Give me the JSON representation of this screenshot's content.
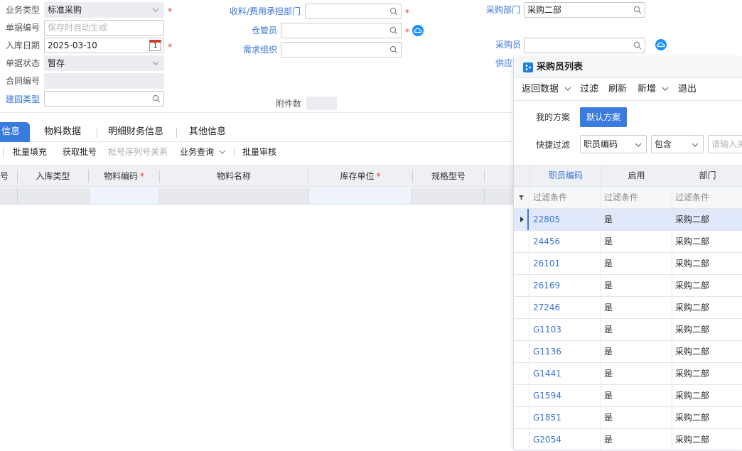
{
  "form": {
    "biz_type_label": "业务类型",
    "biz_type_value": "标准采购",
    "doc_no_label": "单据编号",
    "doc_no_placeholder": "保存时自动生成",
    "in_date_label": "入库日期",
    "in_date_value": "2025-03-10",
    "in_date_icon_day": "1",
    "doc_status_label": "单据状态",
    "doc_status_value": "暂存",
    "contract_label": "合同编号",
    "jianyuan_label": "建园类型",
    "recv_dept_label": "收料/费用承担部门",
    "keeper_label": "仓管员",
    "demand_org_label": "需求组织",
    "attach_label": "附件数",
    "purch_dept_label": "采购部门",
    "purch_dept_value": "采购二部",
    "buyer_label": "采购员",
    "supplier_label": "供应"
  },
  "tabs": [
    "信息",
    "物料数据",
    "明细财务信息",
    "其他信息"
  ],
  "toolbar": {
    "batch_fill": "批量填充",
    "get_batch": "获取批号",
    "batch_serial": "批号序列号关系",
    "biz_query": "业务查询",
    "batch_audit": "批量审核"
  },
  "grid": {
    "columns": [
      "号",
      "入库类型",
      "物料编码",
      "物料名称",
      "库存单位",
      "规格型号"
    ]
  },
  "popup": {
    "title": "采购员列表",
    "menu": [
      "返回数据",
      "过滤",
      "刷新",
      "新增",
      "退出"
    ],
    "my_scheme": "我的方案",
    "default_scheme": "默认方案",
    "quick_filter_label": "快捷过滤",
    "filter_field": "职员编码",
    "filter_op": "包含",
    "filter_placeholder": "请输入关",
    "columns": [
      "职员编码",
      "启用",
      "部门"
    ],
    "filter_cond": "过滤条件",
    "rows": [
      {
        "code": "22805",
        "enabled": "是",
        "dept": "采购二部"
      },
      {
        "code": "24456",
        "enabled": "是",
        "dept": "采购二部"
      },
      {
        "code": "26101",
        "enabled": "是",
        "dept": "采购二部"
      },
      {
        "code": "26169",
        "enabled": "是",
        "dept": "采购二部"
      },
      {
        "code": "27246",
        "enabled": "是",
        "dept": "采购二部"
      },
      {
        "code": "G1103",
        "enabled": "是",
        "dept": "采购二部"
      },
      {
        "code": "G1136",
        "enabled": "是",
        "dept": "采购二部"
      },
      {
        "code": "G1441",
        "enabled": "是",
        "dept": "采购二部"
      },
      {
        "code": "G1594",
        "enabled": "是",
        "dept": "采购二部"
      },
      {
        "code": "G1851",
        "enabled": "是",
        "dept": "采购二部"
      },
      {
        "code": "G2054",
        "enabled": "是",
        "dept": "采购二部"
      }
    ]
  },
  "colors": {
    "accent": "#3a7be0",
    "link": "#3a73d8",
    "required": "#e53935",
    "selected_row": "#dfe9fb"
  }
}
